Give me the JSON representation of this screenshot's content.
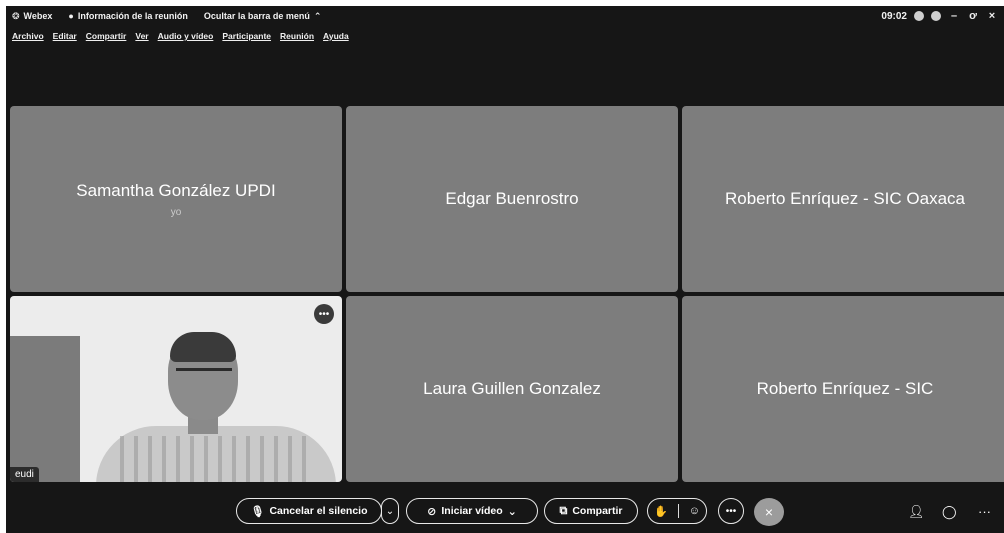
{
  "titlebar": {
    "app_name": "Webex",
    "meeting_info": "Información de la reunión",
    "hide_menu": "Ocultar la barra de menú",
    "time": "09:02",
    "minimize": "–",
    "maximize": "ơ",
    "close": "×"
  },
  "menu": {
    "items": [
      "Archivo",
      "Editar",
      "Compartir",
      "Ver",
      "Audio y vídeo",
      "Participante",
      "Reunión",
      "Ayuda"
    ]
  },
  "participants": [
    {
      "name": "Samantha González UPDI",
      "sub": "yo"
    },
    {
      "name": "Edgar Buenrostro"
    },
    {
      "name": "Roberto Enríquez - SIC Oaxaca"
    },
    {
      "label": "eudi",
      "more": "•••"
    },
    {
      "name": "Laura Guillen Gonzalez"
    },
    {
      "name": "Roberto Enríquez - SIC"
    }
  ],
  "controls": {
    "unmute_label": "Cancelar el silencio",
    "start_video_label": "Iniciar vídeo",
    "share_label": "Compartir",
    "more": "•••",
    "end": "×",
    "right_more": "···"
  }
}
